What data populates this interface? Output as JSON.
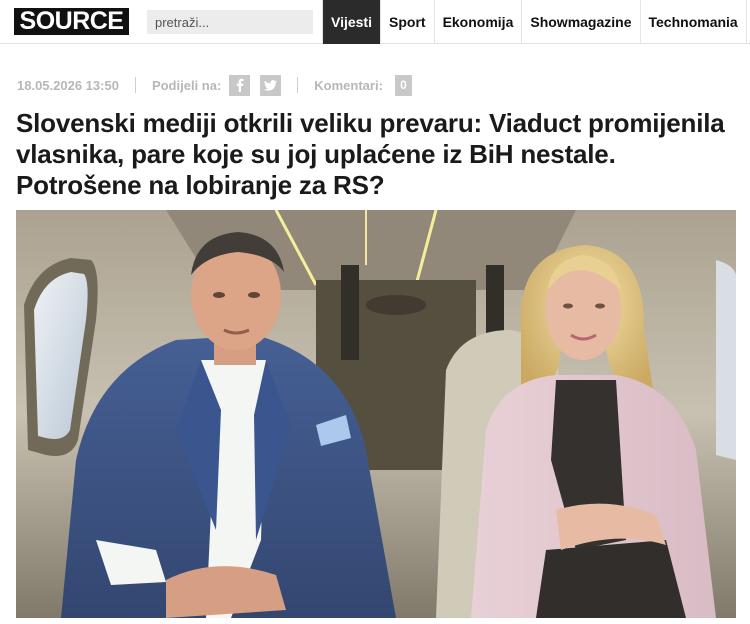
{
  "header": {
    "logo_text": "SOURCE",
    "search_placeholder": "pretraži...",
    "nav": [
      {
        "label": "Vijesti",
        "active": true
      },
      {
        "label": "Sport",
        "active": false
      },
      {
        "label": "Ekonomija",
        "active": false
      },
      {
        "label": "Showmagazine",
        "active": false
      },
      {
        "label": "Technomania",
        "active": false
      }
    ]
  },
  "article": {
    "date": "18.05.2026 13:50",
    "share_label": "Podijeli na:",
    "share_icons": [
      "facebook-icon",
      "twitter-icon"
    ],
    "comments_label": "Komentari:",
    "comments_count": "0",
    "title": "Slovenski mediji otkrili veliku prevaru: Viaduct promijenila vlasnika, pare koje su joj uplaćene iz BiH nestale. Potrošene na lobiranje za RS?"
  },
  "colors": {
    "active_nav_bg": "#2b2b2b",
    "meta_text": "#b7b7b7",
    "share_button_bg": "#c8c8c8"
  }
}
